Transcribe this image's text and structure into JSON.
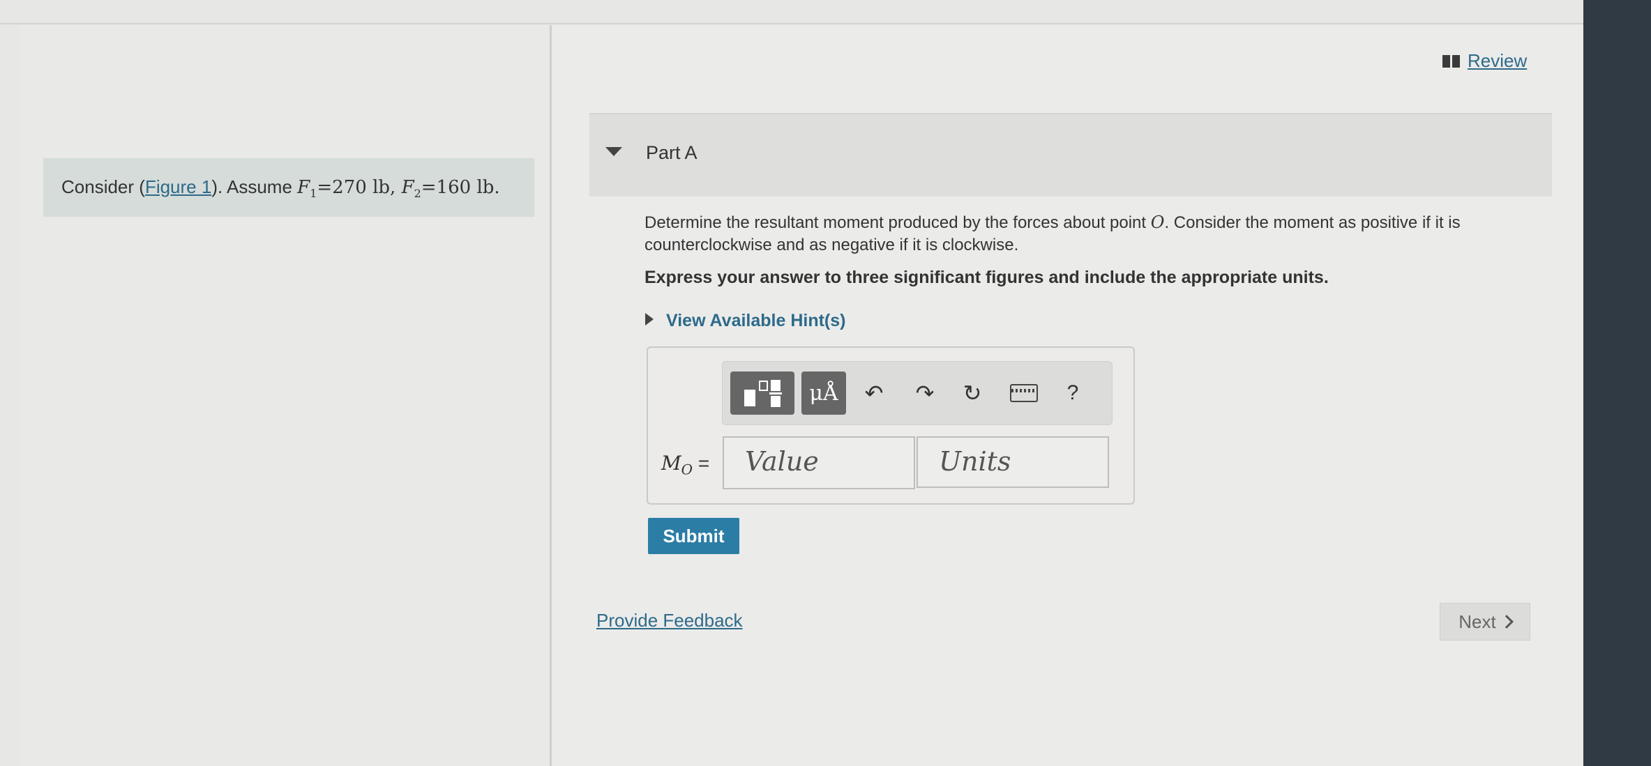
{
  "header": {
    "review_label": "Review",
    "review_icon": "book-icon"
  },
  "problem": {
    "prefix": "Consider (",
    "figure_link": "Figure 1",
    "suffix": "). Assume ",
    "f1_symbol": "F",
    "f1_sub": "1",
    "f1_value": "=270 lb, ",
    "f2_symbol": "F",
    "f2_sub": "2",
    "f2_value": "=160 lb."
  },
  "part_a": {
    "title": "Part A",
    "question_start": "Determine the resultant moment produced by the forces about point ",
    "point": "O",
    "question_end": ". Consider the moment as positive if it is counterclockwise and as negative if it is clockwise.",
    "instruction": "Express your answer to three significant figures and include the appropriate units.",
    "hint_label": "View Available Hint(s)"
  },
  "answer": {
    "label_M": "M",
    "label_sub": "O",
    "label_eq": " =",
    "value_placeholder": "Value",
    "units_placeholder": "Units",
    "units_button": "μÅ",
    "undo_glyph": "↶",
    "redo_glyph": "↷",
    "reset_glyph": "↻",
    "help_glyph": "?"
  },
  "actions": {
    "submit": "Submit",
    "feedback": "Provide Feedback",
    "next": "Next"
  },
  "colors": {
    "link": "#2d6a8a",
    "submit_bg": "#2c7da6",
    "problem_bg": "#d5dcd9"
  }
}
